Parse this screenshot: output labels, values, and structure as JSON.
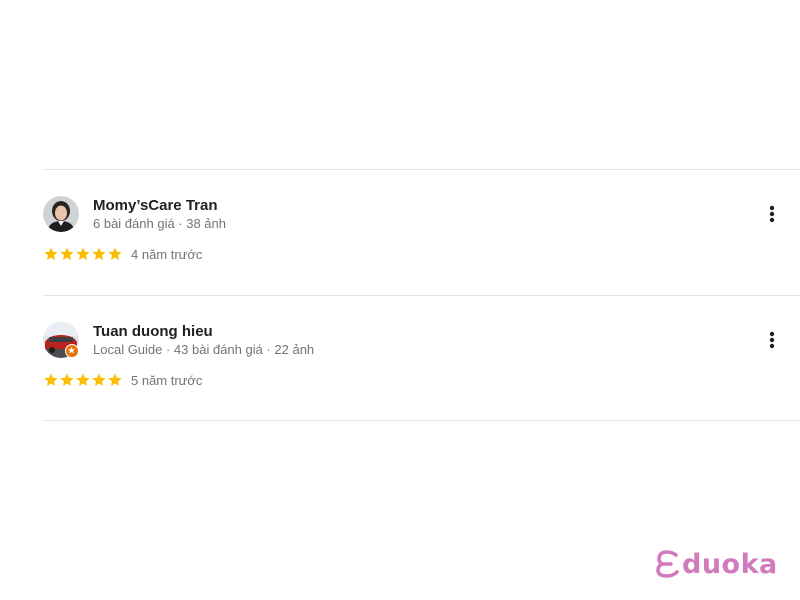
{
  "reviews": [
    {
      "name": "Momy’sCare Tran",
      "meta": "6 bài đánh giá · 38 ảnh",
      "rating": 5,
      "time": "4 năm trước",
      "local_guide": false
    },
    {
      "name": "Tuan duong hieu",
      "meta": "Local Guide · 43 bài đánh giá · 22 ảnh",
      "rating": 5,
      "time": "5 năm trước",
      "local_guide": true
    }
  ],
  "brand": {
    "text": "duoka"
  },
  "colors": {
    "star": "#fbbc04",
    "divider": "#e2e2e2",
    "name": "#202124",
    "secondary": "#70757a",
    "brand": "#d17bbd",
    "local_guide_badge": "#e8710a"
  },
  "icons": {
    "more": "more-vert-icon",
    "star": "star-icon",
    "local_guide": "local-guide-badge-icon"
  }
}
